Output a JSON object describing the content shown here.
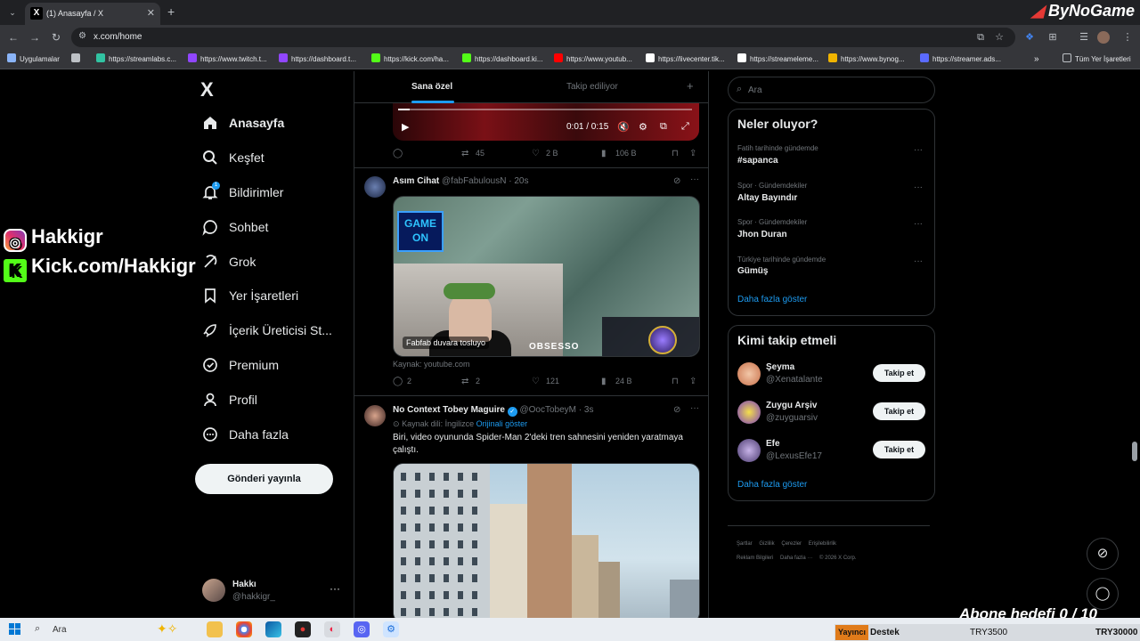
{
  "browser": {
    "tab_title": "(1) Anasayfa / X",
    "url": "x.com/home",
    "brand": "ByNoGame",
    "bookmarks": [
      {
        "label": "Uygulamalar",
        "color": "#e8eaed"
      },
      {
        "label": "https://streamlabs.c...",
        "color": "#31c3a2"
      },
      {
        "label": "https://www.twitch.t...",
        "color": "#9146ff"
      },
      {
        "label": "https://dashboard.t...",
        "color": "#9146ff"
      },
      {
        "label": "https://kick.com/ha...",
        "color": "#53fc18"
      },
      {
        "label": "https://dashboard.ki...",
        "color": "#53fc18"
      },
      {
        "label": "https://www.youtub...",
        "color": "#ff0000"
      },
      {
        "label": "https://livecenter.tik...",
        "color": "#ffffff"
      },
      {
        "label": "https://streameleme...",
        "color": "#ffffff"
      },
      {
        "label": "https://www.bynog...",
        "color": "#f0b400"
      },
      {
        "label": "https://streamer.ads...",
        "color": "#5b6bff"
      }
    ],
    "all_bookmarks": "Tüm Yer İşaretleri"
  },
  "sidebar": {
    "logo": "X",
    "items": [
      {
        "label": "Anasayfa",
        "icon": "home-icon",
        "active": true
      },
      {
        "label": "Keşfet",
        "icon": "search-icon"
      },
      {
        "label": "Bildirimler",
        "icon": "bell-icon"
      },
      {
        "label": "Sohbet",
        "icon": "chat-icon"
      },
      {
        "label": "Grok",
        "icon": "grok-icon"
      },
      {
        "label": "Yer İşaretleri",
        "icon": "bookmark-icon"
      },
      {
        "label": "İçerik Üreticisi St...",
        "icon": "rocket-icon"
      },
      {
        "label": "Premium",
        "icon": "verified-badge-icon"
      },
      {
        "label": "Profil",
        "icon": "person-icon"
      },
      {
        "label": "Daha fazla",
        "icon": "more-circle-icon"
      }
    ],
    "notif_count": "1",
    "post_button": "Gönderi yayınla",
    "profile": {
      "name": "Hakkı",
      "handle": "@hakkigr_"
    }
  },
  "feed": {
    "tabs": [
      "Sana özel",
      "Takip ediliyor"
    ],
    "tweet1": {
      "video_time": "0:01 / 0:15",
      "video_progress": 0.04,
      "replies": "",
      "retweets": "45",
      "likes": "2 B",
      "views": "106 B"
    },
    "tweet2": {
      "name": "Asım Cihat",
      "handle": "@fabFabulousN",
      "time": "20s",
      "caption": "Fabfab duvara tosluyo",
      "source": "Kaynak: youtube.com",
      "replies": "2",
      "retweets": "2",
      "likes": "121",
      "views": "24 B"
    },
    "tweet3": {
      "name": "No Context Tobey Maguire",
      "handle": "@OocTobeyM",
      "time": "3s",
      "source_lang": "Kaynak dili: İngilizce",
      "show_original": "Orijinali göster",
      "text": "Biri, video oyununda Spider-Man 2'deki tren sahnesini yeniden yaratmaya çalıştı."
    }
  },
  "right": {
    "search_placeholder": "Ara",
    "trends_title": "Neler oluyor?",
    "trends": [
      {
        "meta": "Fatih tarihinde gündemde",
        "name": "#sapanca"
      },
      {
        "meta": "Spor · Gündemdekiler",
        "name": "Altay Bayındır"
      },
      {
        "meta": "Spor · Gündemdekiler",
        "name": "Jhon Duran"
      },
      {
        "meta": "Türkiye tarihinde gündemde",
        "name": "Gümüş"
      }
    ],
    "trends_more": "Daha fazla göster",
    "wtf_title": "Kimi takip etmeli",
    "who_to_follow": [
      {
        "name": "Şeyma",
        "handle": "@Xenatalante",
        "button": "Takip et"
      },
      {
        "name": "Zuygu Arşiv",
        "handle": "@zuyguarsiv",
        "button": "Takip et"
      },
      {
        "name": "Efe",
        "handle": "@LexusEfe17",
        "button": "Takip et"
      }
    ],
    "wtf_more": "Daha fazla göster",
    "footer": [
      "Şartlar",
      "Gizlilik",
      "Çerezler",
      "Erişilebilirlik",
      "Reklam Bilgileri",
      "Daha fazla ···",
      "© 2026 X Corp."
    ]
  },
  "overlay": {
    "instagram": "Hakkigr",
    "kick": "Kick.com/Hakkigr",
    "goal": "Abone hedefi 0 / 10"
  },
  "taskbar": {
    "search_placeholder": "Ara",
    "widget_tag": "Yayıncı",
    "widget_label": "Destek",
    "widget_value1": "TRY3500",
    "widget_value2": "TRY30000"
  }
}
